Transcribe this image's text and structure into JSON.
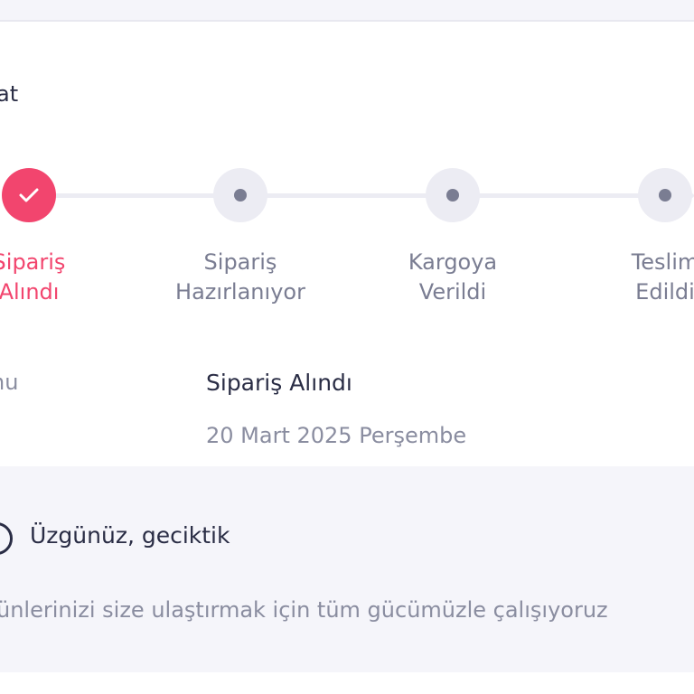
{
  "card": {
    "title": "at"
  },
  "steps": [
    {
      "line1": "Sipariş",
      "line2": "Alındı",
      "status": "done",
      "icon": "check-icon"
    },
    {
      "line1": "Sipariş",
      "line2": "Hazırlanıyor",
      "status": "pending",
      "icon": "dot-icon"
    },
    {
      "line1": "Kargoya",
      "line2": "Verildi",
      "status": "pending",
      "icon": "dot-icon"
    },
    {
      "line1": "Teslim",
      "line2": "Edildi",
      "status": "pending",
      "icon": "dot-icon"
    }
  ],
  "info": {
    "label": "nu",
    "status": "Sipariş Alındı",
    "date": "20 Mart 2025 Perşembe"
  },
  "notice": {
    "icon": "info-circle-icon",
    "title": "Üzgünüz, geciktik",
    "text": "ünlerinizi size ulaştırmak için tüm gücümüzle çalışıyoruz"
  },
  "colors": {
    "accent": "#f2456e",
    "text_dark": "#2a2d45",
    "text_muted": "#7a7d92",
    "track": "#ececf3",
    "background": "#f5f5fa"
  }
}
